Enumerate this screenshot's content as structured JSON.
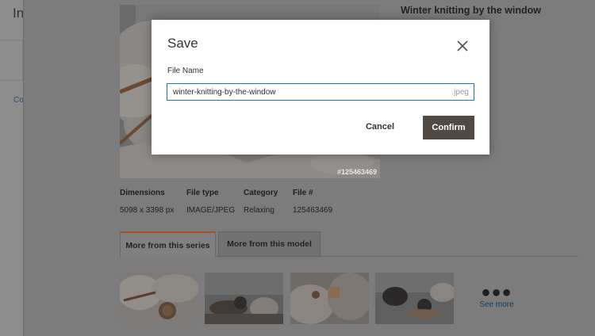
{
  "background": {
    "title": "In",
    "link": "Co"
  },
  "detail": {
    "title": "Winter knitting by the window",
    "photo_id": "#125463469",
    "meta": [
      {
        "header": "Dimensions",
        "value": "5098 x 3398 px"
      },
      {
        "header": "File type",
        "value": "IMAGE/JPEG"
      },
      {
        "header": "Category",
        "value": "Relaxing"
      },
      {
        "header": "File #",
        "value": "125463469"
      }
    ],
    "tabs": {
      "active": "More from this series",
      "inactive": "More from this model"
    },
    "see_more": "See more",
    "dots": "●●●"
  },
  "modal": {
    "title": "Save",
    "field_label": "File Name",
    "file_name": "winter-knitting-by-the-window",
    "suffix": ".jpeg",
    "cancel_label": "Cancel",
    "confirm_label": "Confirm"
  },
  "colors": {
    "confirm_bg": "#514943",
    "active_tab_accent": "#a15225",
    "input_border": "#1979c3",
    "link": "#1979c3"
  },
  "icons": [
    "close-icon",
    "ellipsis-icon"
  ]
}
